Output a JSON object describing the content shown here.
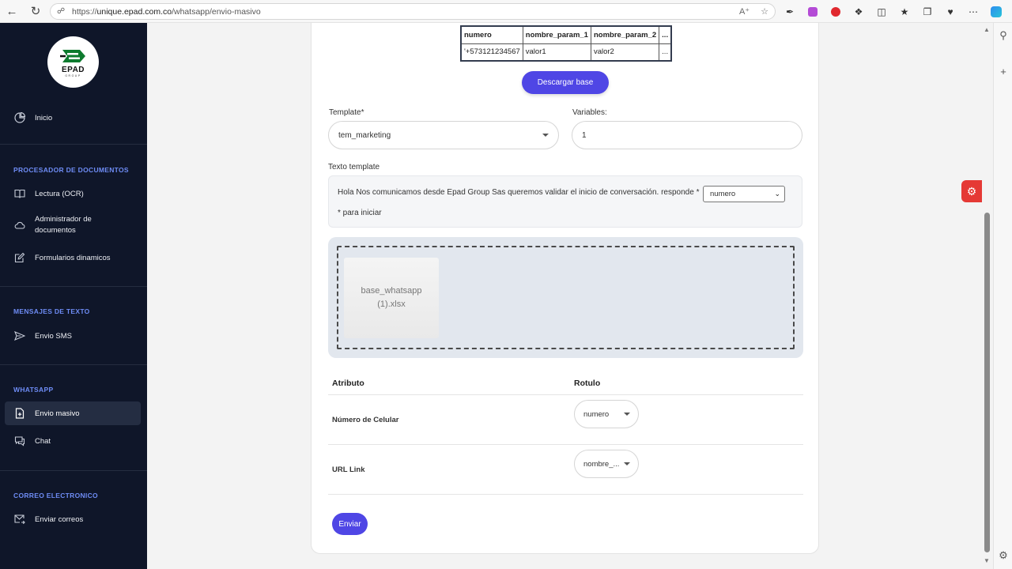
{
  "browser": {
    "url_prefix": "https://",
    "url_host": "unique.epad.com.co",
    "url_path": "/whatsapp/envio-masivo"
  },
  "sidebar": {
    "logo_text": "EPAD",
    "logo_sub": "GROUP",
    "home": "Inicio",
    "sections": [
      {
        "title": "PROCESADOR DE DOCUMENTOS",
        "items": [
          "Lectura (OCR)",
          "Administrador de documentos",
          "Formularios dinamicos"
        ]
      },
      {
        "title": "MENSAJES DE TEXTO",
        "items": [
          "Envio SMS"
        ]
      },
      {
        "title": "WHATSAPP",
        "items": [
          "Envio masivo",
          "Chat"
        ]
      },
      {
        "title": "CORREO ELECTRONICO",
        "items": [
          "Enviar correos"
        ]
      }
    ],
    "admin_line1": "Administrador de",
    "admin_line2": "documentos"
  },
  "preview_table": {
    "headers": [
      "numero",
      "nombre_param_1",
      "nombre_param_2",
      "..."
    ],
    "row": [
      "'+573121234567",
      "valor1",
      "valor2",
      "..."
    ]
  },
  "download_button": "Descargar base",
  "template": {
    "label": "Template*",
    "value": "tem_marketing"
  },
  "variables": {
    "label": "Variables:",
    "value": "1"
  },
  "texto_template": {
    "label": "Texto template",
    "text_before": "Hola Nos comunicamos desde Epad Group Sas queremos validar el inicio de conversación. responde *",
    "select_value": "numero",
    "text_after": "* para iniciar"
  },
  "upload": {
    "file_name": "base_whatsapp (1).xlsx"
  },
  "mapping": {
    "col_attribute": "Atributo",
    "col_label": "Rotulo",
    "rows": [
      {
        "attribute": "Número de Celular",
        "value": "numero"
      },
      {
        "attribute": "URL Link",
        "value": "nombre_..."
      }
    ]
  },
  "send_button": "Enviar",
  "colors": {
    "sidebar_bg": "#0f1629",
    "section_title": "#6e8cf5",
    "primary": "#4f46e5",
    "fab": "#e53935"
  }
}
